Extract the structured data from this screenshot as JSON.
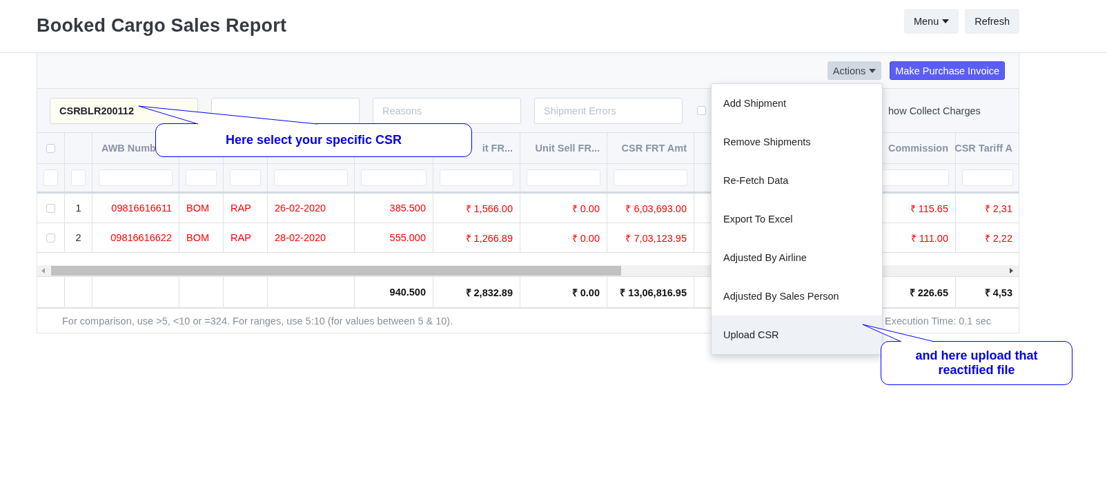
{
  "header": {
    "title": "Booked Cargo Sales Report",
    "buttons": [
      {
        "label": "Menu",
        "dropdown": true
      },
      {
        "label": "Refresh",
        "dropdown": false
      }
    ]
  },
  "toolbar": {
    "buttons": [
      {
        "kind": "dropdown",
        "label": "Actions"
      },
      {
        "kind": "primary",
        "label": "Make Purchase Invoice"
      }
    ]
  },
  "filters": [
    {
      "kind": "field",
      "value": "CSRBLR200112"
    },
    {
      "kind": "field"
    },
    {
      "kind": "field",
      "placeholder": "Reasons"
    },
    {
      "kind": "field",
      "placeholder": "Shipment Errors"
    },
    {
      "kind": "checkbox",
      "checked": false,
      "label": "how Collect Charges"
    }
  ],
  "table": {
    "select_all": {
      "checked": false
    },
    "columns": [
      {
        "kind": "index"
      },
      {
        "kind": "id",
        "header": "AWB Numb"
      },
      {
        "kind": "text"
      },
      {
        "kind": "text"
      },
      {
        "kind": "text"
      },
      {
        "kind": "number"
      },
      {
        "kind": "number",
        "header": "it FR..."
      },
      {
        "kind": "number",
        "header": "Unit Sell FR..."
      },
      {
        "kind": "number",
        "header": "CSR FRT Amt"
      },
      {
        "kind": "covered"
      },
      {
        "kind": "covered"
      },
      {
        "kind": "number",
        "header": "Commission"
      },
      {
        "kind": "number",
        "header": "CSR Tariff A"
      }
    ],
    "rows": [
      {
        "checked": false,
        "cells": [
          "1",
          "09816616611",
          "BOM",
          "RAP",
          "26-02-2020",
          "385.500",
          "₹ 1,566.00",
          "₹ 0.00",
          "₹ 6,03,693.00",
          "₹ 115.65",
          "₹ 2,31"
        ]
      },
      {
        "checked": false,
        "cells": [
          "2",
          "09816616622",
          "BOM",
          "RAP",
          "28-02-2020",
          "555.000",
          "₹ 1,266.89",
          "₹ 0.00",
          "₹ 7,03,123.95",
          "₹ 111.00",
          "₹ 2,22"
        ]
      }
    ],
    "totals": [
      "940.500",
      "₹ 2,832.89",
      "₹ 0.00",
      "₹ 13,06,816.95",
      "₹ 226.65",
      "₹ 4,53"
    ]
  },
  "footer": {
    "hint": "For comparison, use >5, <10 or =324. For ranges, use 5:10 (for values between 5 & 10).",
    "execution_time": "Execution Time: 0.1 sec"
  },
  "actions_menu": {
    "items": [
      {
        "label": "Add Shipment",
        "selected": false
      },
      {
        "label": "Remove Shipments",
        "selected": false
      },
      {
        "label": "Re-Fetch Data",
        "selected": false
      },
      {
        "label": "Export To Excel",
        "selected": false
      },
      {
        "label": "Adjusted By Airline",
        "selected": false
      },
      {
        "label": "Adjusted By Sales Person",
        "selected": false
      },
      {
        "label": "Upload CSR",
        "selected": true
      }
    ]
  },
  "callouts": [
    {
      "text": "Here select your specific CSR"
    },
    {
      "text": "and here upload that reactified file"
    }
  ]
}
